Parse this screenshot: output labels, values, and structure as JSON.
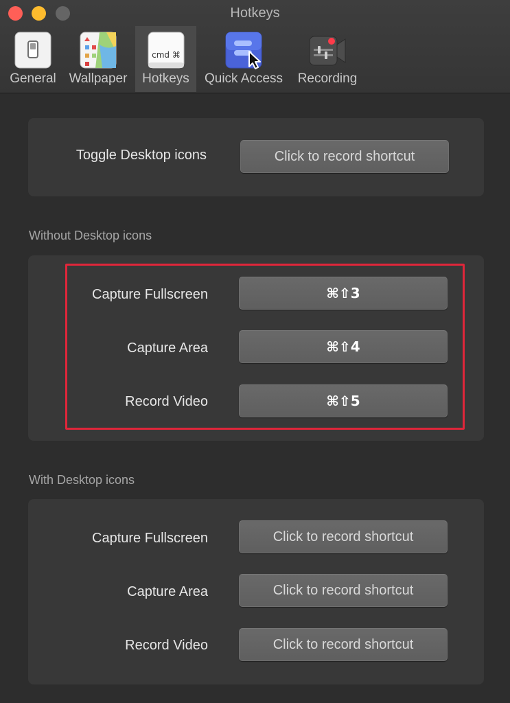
{
  "window": {
    "title": "Hotkeys"
  },
  "tabs": [
    {
      "label": "General",
      "icon": "switch-icon"
    },
    {
      "label": "Wallpaper",
      "icon": "wallpaper-icon"
    },
    {
      "label": "Hotkeys",
      "icon": "keyboard-command-icon",
      "icon_text": "cmd ⌘",
      "selected": true
    },
    {
      "label": "Quick Access",
      "icon": "quick-access-icon"
    },
    {
      "label": "Recording",
      "icon": "video-camera-icon"
    }
  ],
  "toggle_section": {
    "label": "Toggle Desktop icons",
    "button": "Click to record shortcut"
  },
  "without_icons": {
    "title": "Without Desktop icons",
    "rows": [
      {
        "label": "Capture Fullscreen",
        "shortcut": "⌘⇧3"
      },
      {
        "label": "Capture Area",
        "shortcut": "⌘⇧4"
      },
      {
        "label": "Record Video",
        "shortcut": "⌘⇧5"
      }
    ]
  },
  "with_icons": {
    "title": "With Desktop icons",
    "rows": [
      {
        "label": "Capture Fullscreen",
        "shortcut": "Click to record shortcut"
      },
      {
        "label": "Capture Area",
        "shortcut": "Click to record shortcut"
      },
      {
        "label": "Record Video",
        "shortcut": "Click to record shortcut"
      }
    ]
  },
  "colors": {
    "background": "#2d2d2d",
    "panel": "#383838",
    "button": "#646464",
    "highlight": "#e0263a"
  }
}
